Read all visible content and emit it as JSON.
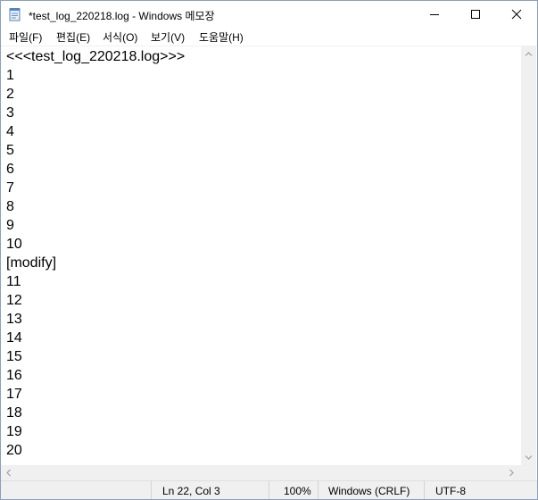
{
  "window": {
    "title": "*test_log_220218.log - Windows 메모장"
  },
  "menu": {
    "items": [
      "파일(F)",
      "편집(E)",
      "서식(O)",
      "보기(V)",
      "도움말(H)"
    ]
  },
  "editor": {
    "lines": [
      "<<<test_log_220218.log>>>",
      "1",
      "2",
      "3",
      "4",
      "5",
      "6",
      "7",
      "8",
      "9",
      "10",
      "[modify]",
      "11",
      "12",
      "13",
      "14",
      "15",
      "16",
      "17",
      "18",
      "19",
      "20"
    ]
  },
  "status": {
    "position": "Ln 22, Col 3",
    "zoom": "100%",
    "line_ending": "Windows (CRLF)",
    "encoding": "UTF-8"
  }
}
